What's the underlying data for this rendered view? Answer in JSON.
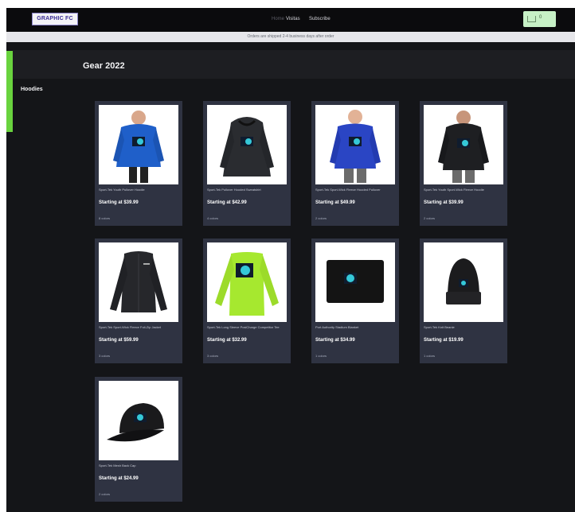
{
  "header": {
    "logo_text": "GRAPHIC FC",
    "nav": [
      {
        "label": "Home"
      },
      {
        "label": "Visitas"
      },
      {
        "label": "Subscribe"
      }
    ],
    "cart_count": "0",
    "announcement": "Orders are shipped 2-4 business days after order"
  },
  "collection": {
    "title": "Gear 2022",
    "sidebar_heading": "Hoodies"
  },
  "colors": {
    "accent_green": "#69d33e",
    "card_bg": "#2f3342",
    "page_bg": "#141518"
  },
  "products": [
    {
      "title": "Sport-Tek Youth Pullover Hoodie",
      "price": "Starting at $39.99",
      "meta": "8 colors",
      "icon": "blue-hoodie-image"
    },
    {
      "title": "Sport-Tek Pullover Hooded Sweatshirt",
      "price": "Starting at $42.99",
      "meta": "4 colors",
      "icon": "black-hoodie-image"
    },
    {
      "title": "Sport-Tek Sport-Wick Fleece Hooded Pullover",
      "price": "Starting at $49.99",
      "meta": "2 colors",
      "icon": "blue-pullover-image"
    },
    {
      "title": "Sport-Tek Youth Sport-Wick Fleece Hoodie",
      "price": "Starting at $39.99",
      "meta": "2 colors",
      "icon": "black-youth-hoodie-image"
    },
    {
      "title": "Sport-Tek Sport-Wick Fleece Full-Zip Jacket",
      "price": "Starting at $59.99",
      "meta": "3 colors",
      "icon": "black-jacket-image"
    },
    {
      "title": "Sport-Tek Long Sleeve PosiCharge Competitor Tee",
      "price": "Starting at $32.99",
      "meta": "3 colors",
      "icon": "lime-longsleeve-image"
    },
    {
      "title": "Port Authority Stadium Blanket",
      "price": "Starting at $34.99",
      "meta": "1 colors",
      "icon": "blanket-image"
    },
    {
      "title": "Sport-Tek Knit Beanie",
      "price": "Starting at $19.99",
      "meta": "1 colors",
      "icon": "beanie-image"
    },
    {
      "title": "Sport-Tek Mesh Back Cap",
      "price": "Starting at $24.99",
      "meta": "2 colors",
      "icon": "cap-image"
    }
  ]
}
